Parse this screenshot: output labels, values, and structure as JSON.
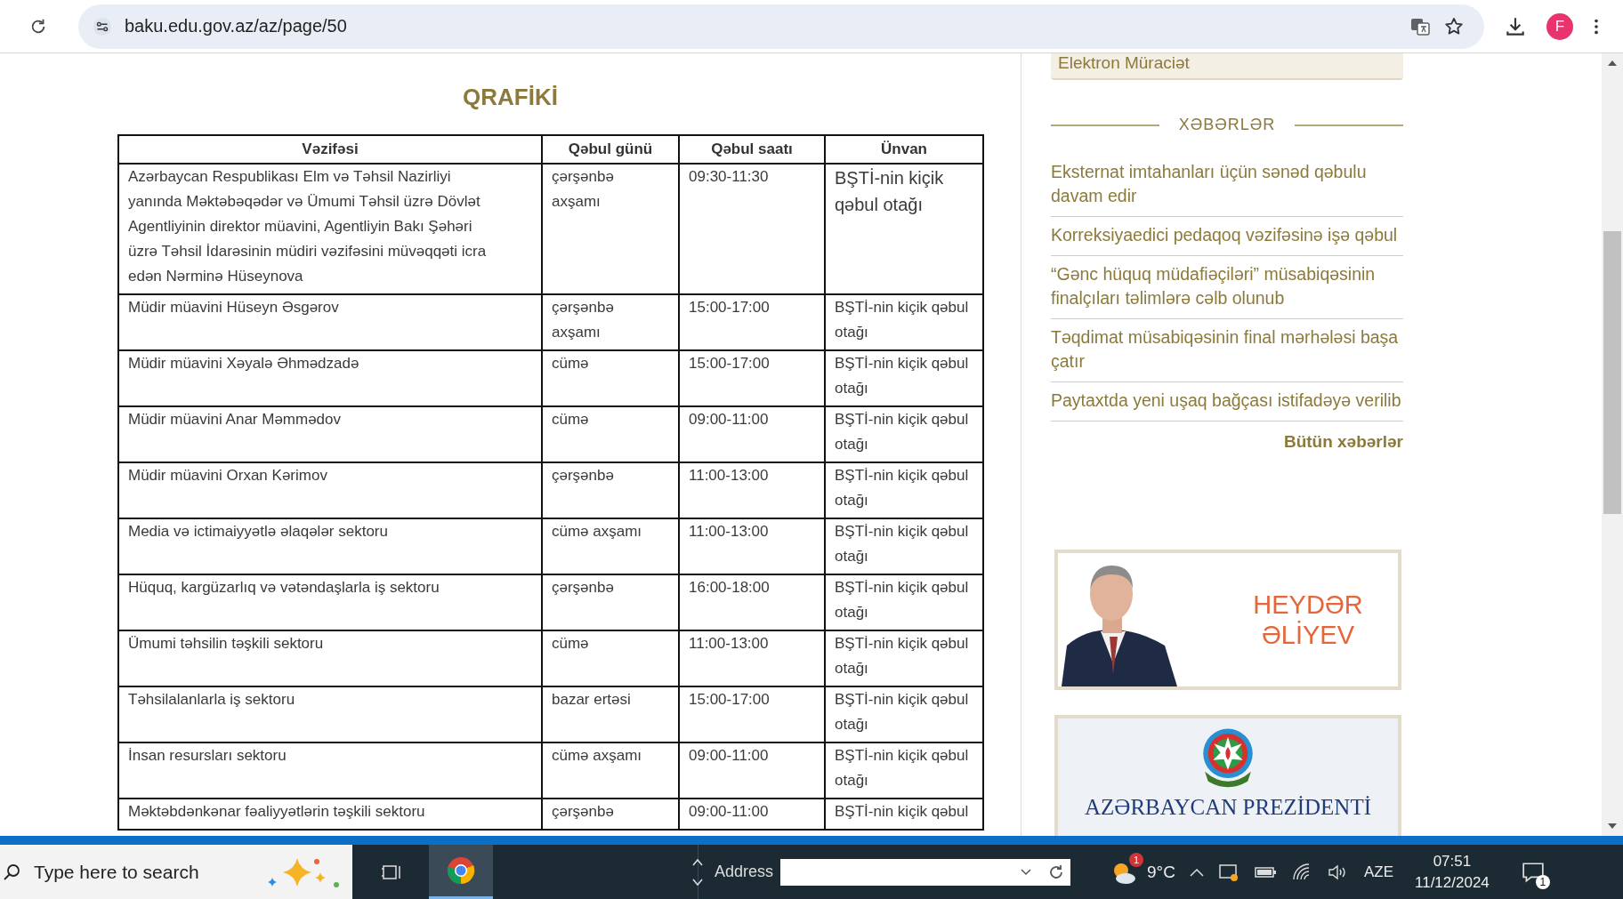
{
  "browser": {
    "url": "baku.edu.gov.az/az/page/50",
    "profile_initial": "F"
  },
  "page": {
    "title": "QRAFİKİ",
    "table": {
      "columns": [
        "Vəzifəsi",
        "Qəbul günü",
        "Qəbul saatı",
        "Ünvan"
      ],
      "rows": [
        {
          "kind": "lead",
          "cells": [
            "Azərbaycan Respublikası Elm və Təhsil Nazirliyi yanında Məktəbəqədər və Ümumi Təhsil üzrə Dövlət Agentliyinin direktor müavini, Agentliyin Bakı Şəhəri üzrə  Təhsil  İdarəsinin müdiri vəzifəsini müvəqqəti icra edən Nərminə Hüseynova",
            "çərşənbə axşamı",
            "09:30-11:30",
            "BŞTİ-nin kiçik qəbul otağı"
          ]
        },
        {
          "kind": "regular",
          "cells": [
            "Müdir müavini Hüseyn Əsgərov",
            "çərşənbə axşamı",
            "15:00-17:00",
            "BŞTİ-nin kiçik qəbul otağı"
          ]
        },
        {
          "kind": "regular",
          "cells": [
            "Müdir müavini Xəyalə Əhmədzadə",
            "cümə",
            "15:00-17:00",
            "BŞTİ-nin kiçik qəbul otağı"
          ]
        },
        {
          "kind": "regular",
          "cells": [
            "Müdir müavini Anar Məmmədov",
            "cümə",
            "09:00-11:00",
            "BŞTİ-nin kiçik qəbul otağı"
          ]
        },
        {
          "kind": "regular",
          "cells": [
            "Müdir müavini Orxan Kərimov",
            "çərşənbə",
            "11:00-13:00",
            "BŞTİ-nin kiçik qəbul otağı"
          ]
        },
        {
          "kind": "regular",
          "cells": [
            "Media və ictimaiyyətlə əlaqələr sektoru",
            "cümə axşamı",
            "11:00-13:00",
            "BŞTİ-nin kiçik qəbul otağı"
          ]
        },
        {
          "kind": "regular",
          "cells": [
            "Hüquq, kargüzarlıq və vətəndaşlarla iş sektoru",
            "çərşənbə",
            "16:00-18:00",
            "BŞTİ-nin kiçik qəbul otağı"
          ]
        },
        {
          "kind": "regular",
          "cells": [
            "Ümumi təhsilin təşkili sektoru",
            "cümə",
            "11:00-13:00",
            "BŞTİ-nin kiçik qəbul otağı"
          ]
        },
        {
          "kind": "regular",
          "cells": [
            "Təhsilalanlarla iş sektoru",
            "bazar ertəsi",
            "15:00-17:00",
            "BŞTİ-nin kiçik qəbul otağı"
          ]
        },
        {
          "kind": "regular",
          "cells": [
            "İnsan resursları sektoru",
            "cümə axşamı",
            "09:00-11:00",
            "BŞTİ-nin kiçik qəbul otağı"
          ]
        },
        {
          "kind": "regular",
          "cells": [
            "Məktəbdənkənar fəaliyyətlərin təşkili sektoru",
            "çərşənbə",
            "09:00-11:00",
            "BŞTİ-nin kiçik qəbul"
          ]
        }
      ]
    }
  },
  "sidebar": {
    "apply_link": "Elektron Müraciət",
    "news_heading": "XƏBƏRLƏR",
    "news": [
      "Eksternat imtahanları üçün sənəd qəbulu davam edir",
      "Korreksiyaedici pedaqoq vəzifəsinə işə qəbul",
      "“Gənc hüquq müdafiəçiləri” müsabiqəsinin finalçıları təlimlərə cəlb olunub",
      "Təqdimat müsabiqəsinin final mərhələsi başa çatır",
      "Paytaxtda yeni uşaq bağçası istifadəyə verilib"
    ],
    "all_news": "Bütün xəbərlər",
    "banners": [
      {
        "kind": "portrait",
        "title_lines": [
          "HEYDƏR",
          "ƏLİYEV"
        ]
      },
      {
        "kind": "emblem",
        "title_lines": [
          "AZƏRBAYCAN PREZİDENTİ"
        ]
      }
    ]
  },
  "taskbar": {
    "search_placeholder": "Type here to search",
    "address_label": "Address",
    "weather_badge": "1",
    "temperature": "9°C",
    "language": "AZE",
    "time": "07:51",
    "date": "11/12/2024",
    "notification_count": "1"
  }
}
